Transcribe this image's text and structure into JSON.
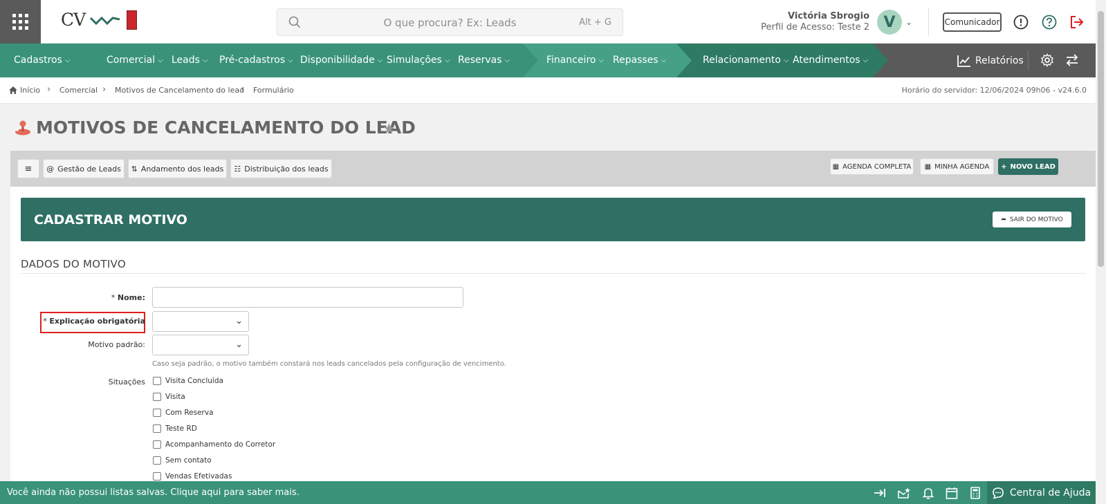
{
  "header": {
    "logo_text": "CV",
    "search_placeholder": "O que procura? Ex: Leads",
    "search_shortcut": "Alt + G",
    "user_name": "Victória Sbrogio",
    "user_profile": "Perfil de Acesso: Teste 2",
    "avatar_initial": "V",
    "comunicador_label": "Comunicador"
  },
  "nav": {
    "items": [
      {
        "label": "Cadastros"
      },
      {
        "label": "Comercial"
      },
      {
        "label": "Leads"
      },
      {
        "label": "Pré-cadastros"
      },
      {
        "label": "Disponibilidade"
      },
      {
        "label": "Simulações"
      },
      {
        "label": "Reservas"
      },
      {
        "label": "Financeiro"
      },
      {
        "label": "Repasses"
      },
      {
        "label": "Relacionamento"
      },
      {
        "label": "Atendimentos"
      }
    ],
    "reports_label": "Relatórios",
    "segment_colors": [
      "#3a9378",
      "#45a085",
      "#2e7a63",
      "#3a9378"
    ]
  },
  "breadcrumb": {
    "items": [
      "Início",
      "Comercial",
      "Motivos de Cancelamento do lead",
      "Formulário"
    ],
    "server_time": "Horário do servidor: 12/06/2024 09h06 - v24.6.0"
  },
  "page": {
    "title": "MOTIVOS DE CANCELAMENTO DO LEAD"
  },
  "toolbar": {
    "menu_icon": "≡",
    "gestao_label": "Gestão de Leads",
    "andamento_label": "Andamento dos leads",
    "distribuicao_label": "Distribuição dos leads",
    "agenda_completa_label": "AGENDA COMPLETA",
    "minha_agenda_label": "MINHA AGENDA",
    "novo_lead_label": "NOVO LEAD"
  },
  "form": {
    "panel_title": "CADASTRAR MOTIVO",
    "exit_label": "SAIR DO MOTIVO",
    "section_title": "DADOS DO MOTIVO",
    "nome_label": "Nome:",
    "nome_value": "",
    "explicacao_label": "Explicação obrigatória",
    "explicacao_value": "",
    "motivo_padrao_label": "Motivo padrão:",
    "motivo_padrao_value": "",
    "motivo_help": "Caso seja padrão, o motivo também constará nos leads cancelados pela configuração de vencimento.",
    "situacoes_label": "Situações",
    "situacoes": [
      {
        "label": "Visita Concluída",
        "checked": false
      },
      {
        "label": "Visita",
        "checked": false
      },
      {
        "label": "Com Reserva",
        "checked": false
      },
      {
        "label": "Teste RD",
        "checked": false
      },
      {
        "label": "Acompanhamento do Corretor",
        "checked": false
      },
      {
        "label": "Sem contato",
        "checked": false
      },
      {
        "label": "Vendas Efetivadas",
        "checked": false
      }
    ]
  },
  "footer": {
    "message": "Você ainda não possui listas salvas. Clique aqui para saber mais.",
    "help_center_label": "Central de Ajuda"
  },
  "colors": {
    "primary_green": "#2f6f64",
    "nav_green": "#3a9378",
    "highlight_red": "#e01e1e"
  }
}
